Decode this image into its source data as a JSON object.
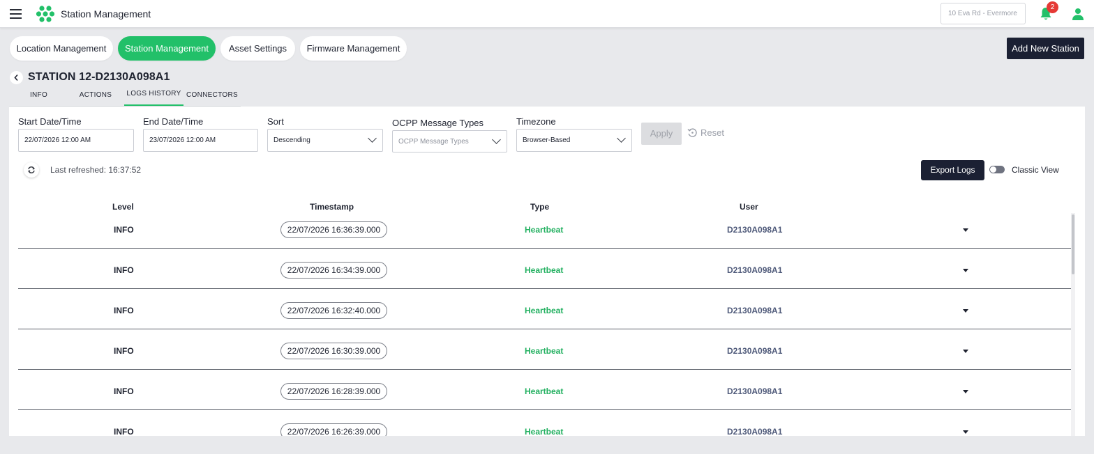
{
  "app": {
    "title": "Station Management",
    "location": "10 Eva Rd - Evermore",
    "notification_count": "2"
  },
  "nav": {
    "pills": [
      "Location Management",
      "Station Management",
      "Asset Settings",
      "Firmware Management"
    ],
    "active_pill": "Station Management",
    "add_station_label": "Add New Station"
  },
  "station": {
    "title": "STATION 12-D2130A098A1",
    "tabs": [
      "INFO",
      "ACTIONS",
      "LOGS HISTORY",
      "CONNECTORS"
    ],
    "active_tab": "LOGS HISTORY"
  },
  "filters": {
    "start_label": "Start Date/Time",
    "start_value": "22/07/2026 12:00 AM",
    "end_label": "End Date/Time",
    "end_value": "23/07/2026 12:00 AM",
    "sort_label": "Sort",
    "sort_value": "Descending",
    "ocpp_label": "OCPP Message Types",
    "ocpp_placeholder": "OCPP Message Types",
    "timezone_label": "Timezone",
    "timezone_value": "Browser-Based",
    "apply_label": "Apply",
    "reset_label": "Reset"
  },
  "toolbar": {
    "last_refreshed": "Last refreshed: 16:37:52",
    "export_label": "Export Logs",
    "classic_view_label": "Classic View",
    "classic_view_on": false
  },
  "table": {
    "headers": [
      "Level",
      "Timestamp",
      "Type",
      "User"
    ],
    "rows": [
      {
        "level": "INFO",
        "timestamp": "22/07/2026 16:36:39.000",
        "type": "Heartbeat",
        "user": "D2130A098A1"
      },
      {
        "level": "INFO",
        "timestamp": "22/07/2026 16:34:39.000",
        "type": "Heartbeat",
        "user": "D2130A098A1"
      },
      {
        "level": "INFO",
        "timestamp": "22/07/2026 16:32:40.000",
        "type": "Heartbeat",
        "user": "D2130A098A1"
      },
      {
        "level": "INFO",
        "timestamp": "22/07/2026 16:30:39.000",
        "type": "Heartbeat",
        "user": "D2130A098A1"
      },
      {
        "level": "INFO",
        "timestamp": "22/07/2026 16:28:39.000",
        "type": "Heartbeat",
        "user": "D2130A098A1"
      },
      {
        "level": "INFO",
        "timestamp": "22/07/2026 16:26:39.000",
        "type": "Heartbeat",
        "user": "D2130A098A1"
      }
    ]
  },
  "colors": {
    "accent": "#22c069",
    "dark_button": "#1b2033",
    "user_text": "#4f5a7a",
    "badge": "#e53935"
  }
}
